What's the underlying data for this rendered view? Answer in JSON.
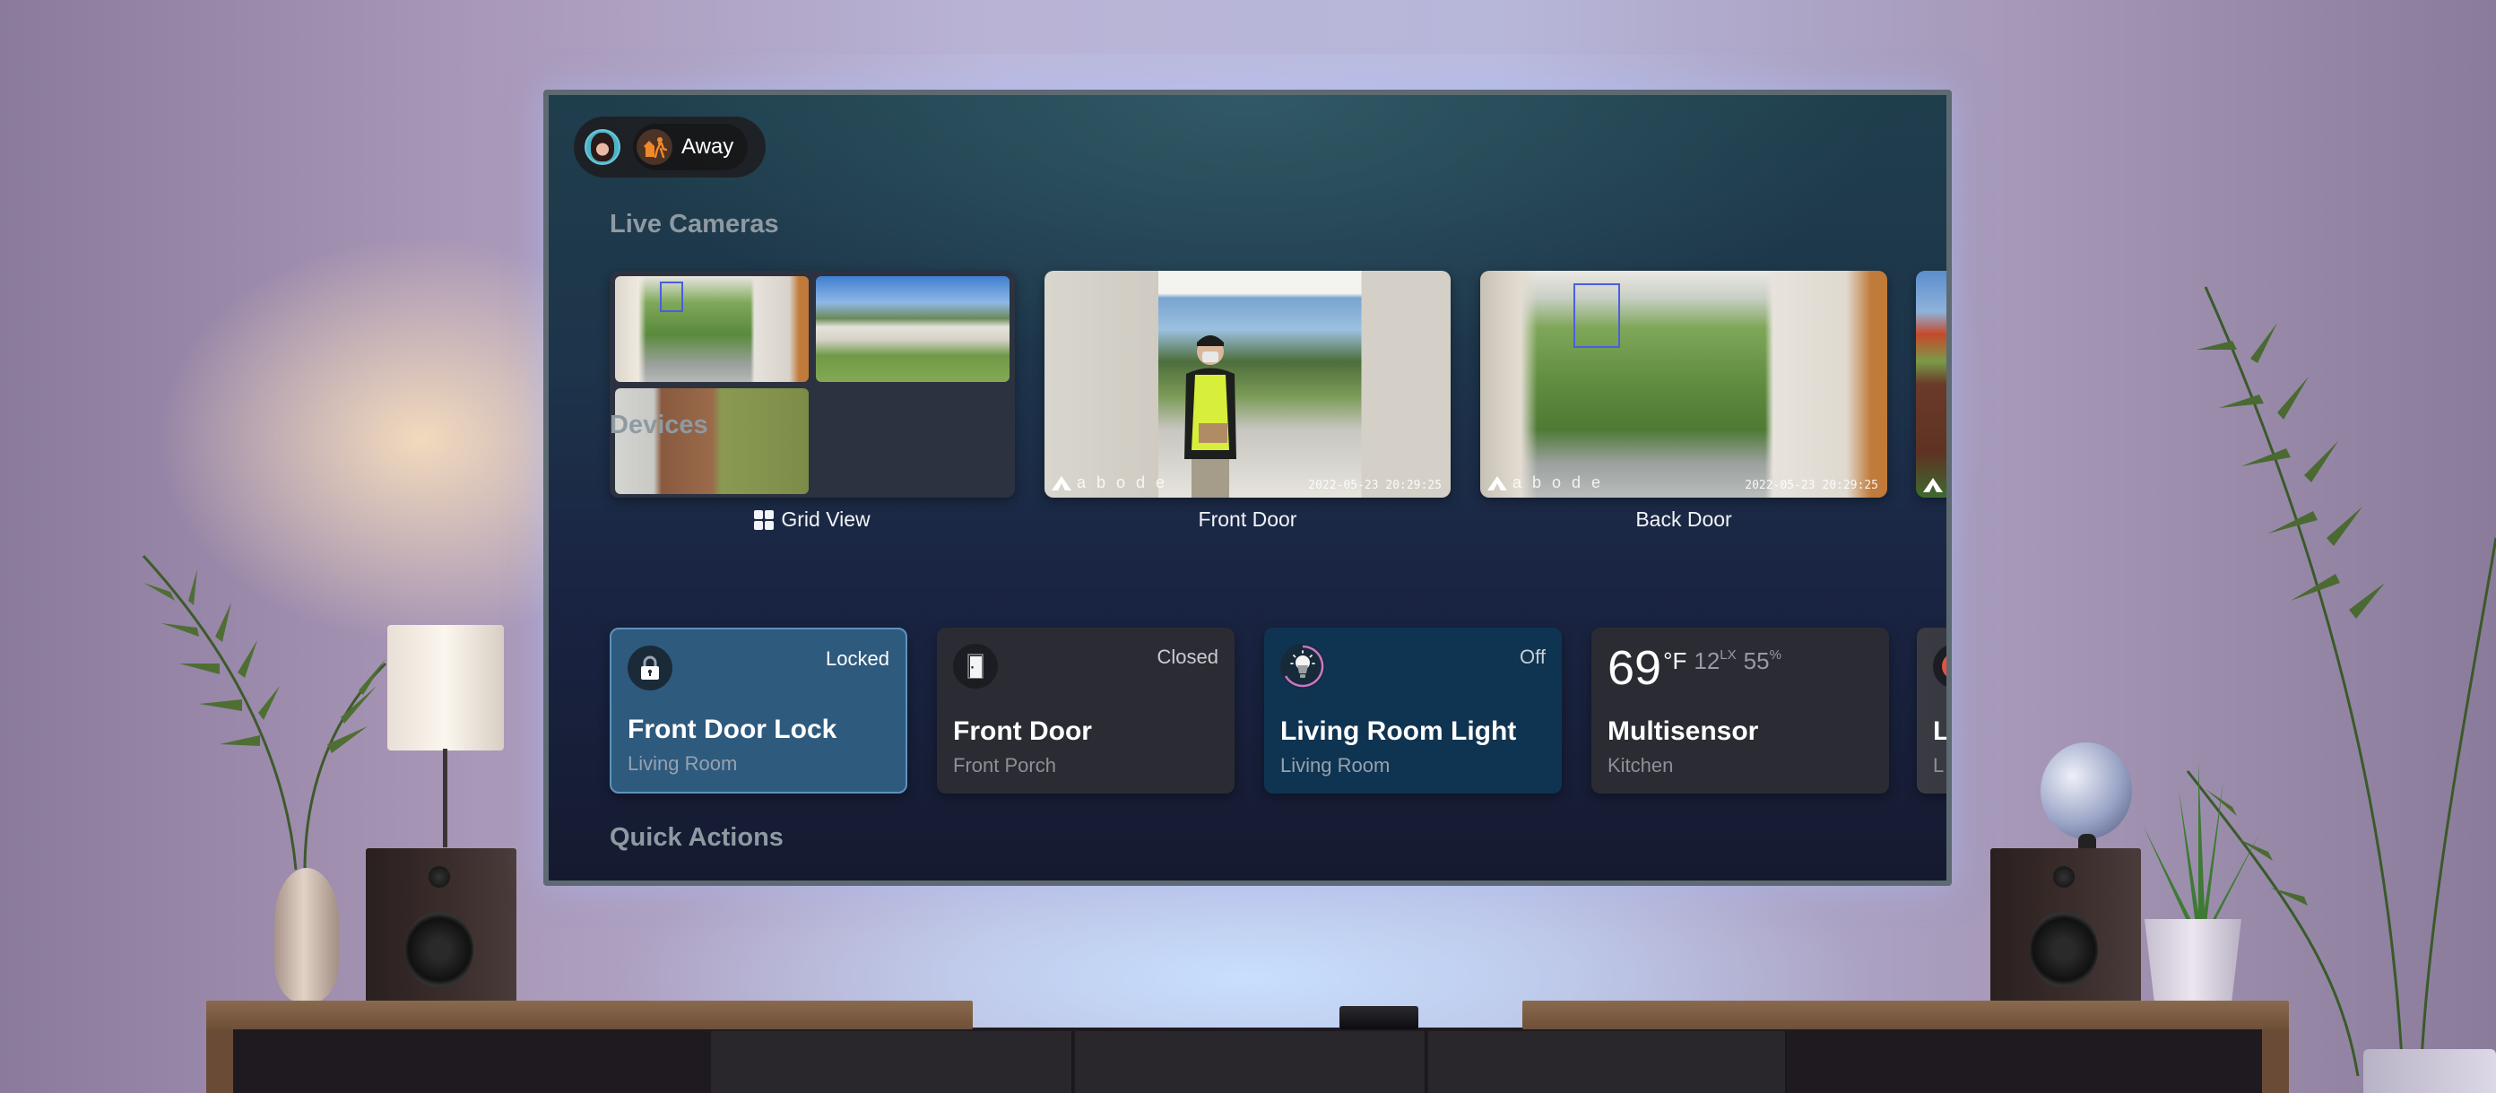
{
  "header": {
    "avatar_alt": "User avatar",
    "mode": {
      "label": "Away",
      "icon": "away-mode-icon",
      "accent": "#f0892a"
    }
  },
  "sections": {
    "live_cameras": "Live Cameras",
    "devices": "Devices",
    "quick_actions": "Quick Actions"
  },
  "cameras": [
    {
      "label": "Grid View",
      "icon": "grid-icon"
    },
    {
      "label": "Front Door",
      "watermark": "abode",
      "timestamp": "2022-05-23 20:29:25"
    },
    {
      "label": "Back Door",
      "watermark": "abode",
      "timestamp": "2022-05-23 20:29:25"
    },
    {
      "label": "",
      "watermark": "abode"
    }
  ],
  "devices": [
    {
      "name": "Front Door Lock",
      "room": "Living Room",
      "state": "Locked",
      "icon": "lock-icon"
    },
    {
      "name": "Front Door",
      "room": "Front Porch",
      "state": "Closed",
      "icon": "door-icon"
    },
    {
      "name": "Living Room Light",
      "room": "Living Room",
      "state": "Off",
      "icon": "lightbulb-icon"
    },
    {
      "name": "Multisensor",
      "room": "Kitchen",
      "readings": {
        "temperature": "69",
        "temperature_unit": "°F",
        "lux": "12",
        "lux_unit": "LX",
        "humidity": "55",
        "humidity_unit": "%"
      }
    },
    {
      "name": "L",
      "room": "L",
      "icon": "partial-device-icon"
    }
  ],
  "colors": {
    "focused_tile": "#2e5a7e",
    "light_ring": "#c877c6",
    "away_accent": "#f0892a"
  }
}
